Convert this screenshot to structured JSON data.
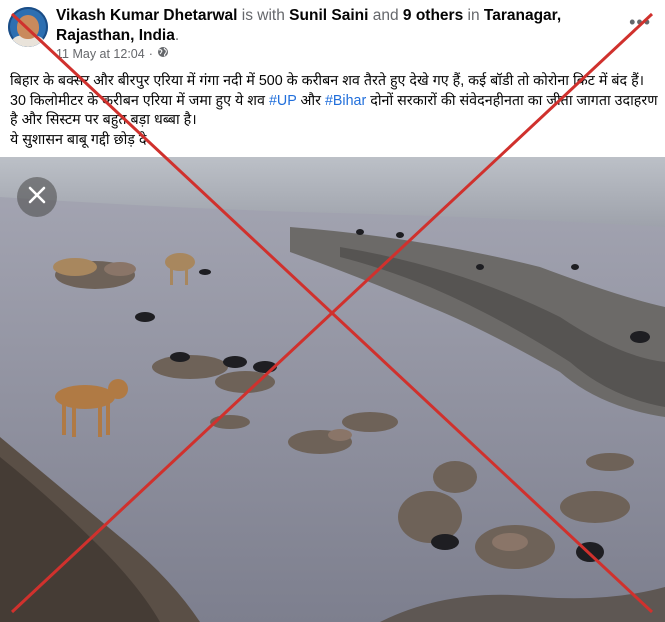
{
  "header": {
    "author": "Vikash Kumar Dhetarwal",
    "is_with": " is with ",
    "tagged": "Sunil Saini",
    "and": " and ",
    "others": "9 others",
    "in": " in ",
    "place": "Taranagar, Rajasthan, India",
    "period": ".",
    "timestamp": "11 May at 12:04",
    "separator": "·",
    "privacy_icon": "globe-icon",
    "more_label": "•••"
  },
  "caption": {
    "line1": "बिहार के बक्सर और बीरपुर एरिया में गंगा नदी में 500 के करीबन शव तैरते हुए देखे गए हैं, कई बॉडी तो कोरोना किट में बंद हैं। 30 किलोमीटर के करीबन एरिया में जमा हुए ये शव ",
    "tag_up": "#UP",
    "mid": " और ",
    "tag_bihar": "#Bihar",
    "line1_end": " दोनों सरकारों की संवेदनहीनता का जीता जागता उदाहरण है और सिस्टम पर बहुत बड़ा धब्बा है।",
    "line2": "ये सुशासन बाबू गद्दी छोड़ दे"
  },
  "photo": {
    "close_icon": "close-icon",
    "overlay": "red-x-mark",
    "overlay_color": "#d0312d"
  }
}
